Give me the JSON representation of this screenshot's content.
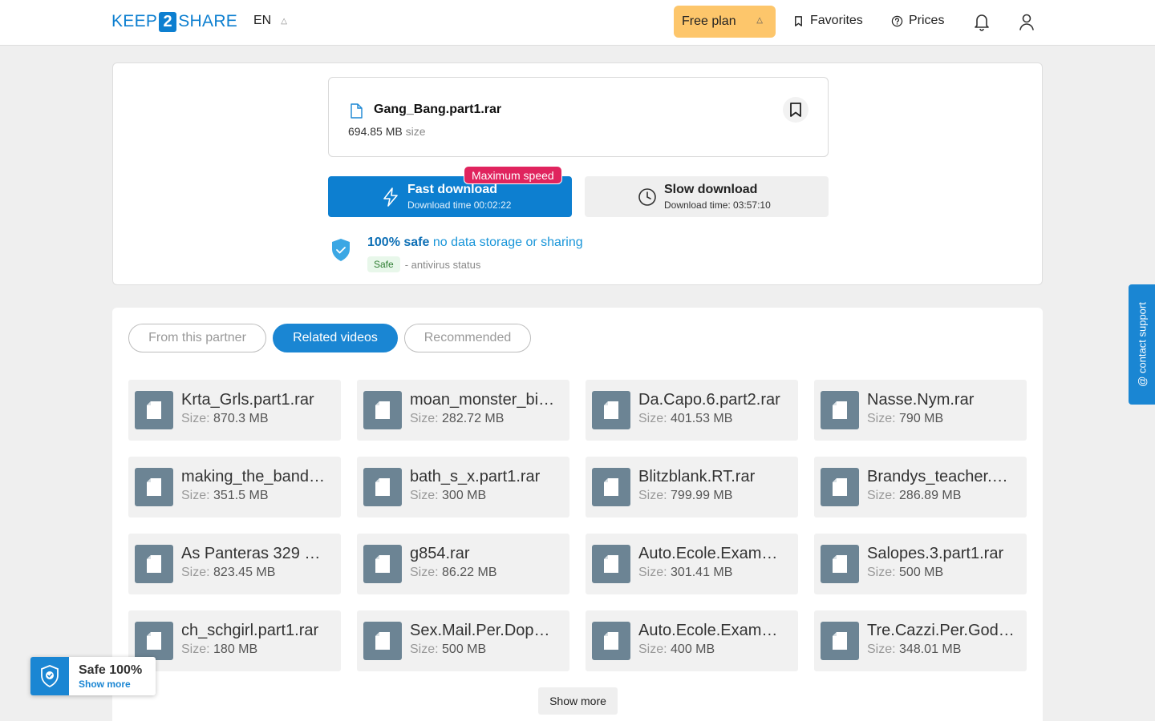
{
  "header": {
    "logo_left": "KEEP",
    "logo_mid": "2",
    "logo_right": "SHARE",
    "lang": "EN",
    "plan": "Free plan",
    "favorites": "Favorites",
    "prices": "Prices"
  },
  "file": {
    "name": "Gang_Bang.part1.rar",
    "size": "694.85 MB",
    "size_label": "size"
  },
  "download": {
    "badge": "Maximum speed",
    "fast_label": "Fast download",
    "fast_time": "Download time 00:02:22",
    "slow_label": "Slow download",
    "slow_time": "Download time: 03:57:10"
  },
  "safety": {
    "strong": "100% safe",
    "rest": "no data storage or sharing",
    "badge": "Safe",
    "status": "- antivirus status"
  },
  "tabs": [
    {
      "label": "From this partner"
    },
    {
      "label": "Related videos"
    },
    {
      "label": "Recommended"
    }
  ],
  "size_prefix": "Size:",
  "items": [
    {
      "name": "Krta_Grls.part1.rar",
      "size": "870.3 MB"
    },
    {
      "name": "moan_monster_bi…",
      "size": "282.72 MB"
    },
    {
      "name": "Da.Capo.6.part2.rar",
      "size": "401.53 MB"
    },
    {
      "name": "Nasse.Nym.rar",
      "size": "790 MB"
    },
    {
      "name": "making_the_band…",
      "size": "351.5 MB"
    },
    {
      "name": "bath_s_x.part1.rar",
      "size": "300 MB"
    },
    {
      "name": "Blitzblank.RT.rar",
      "size": "799.99 MB"
    },
    {
      "name": "Brandys_teacher.…",
      "size": "286.89 MB"
    },
    {
      "name": "As Panteras 329 …",
      "size": "823.45 MB"
    },
    {
      "name": "g854.rar",
      "size": "86.22 MB"
    },
    {
      "name": "Auto.Ecole.Exame…",
      "size": "301.41 MB"
    },
    {
      "name": "Salopes.3.part1.rar",
      "size": "500 MB"
    },
    {
      "name": "ch_schgirl.part1.rar",
      "size": "180 MB"
    },
    {
      "name": "Sex.Mail.Per.Dop…",
      "size": "500 MB"
    },
    {
      "name": "Auto.Ecole.Exame…",
      "size": "400 MB"
    },
    {
      "name": "Tre.Cazzi.Per.God…",
      "size": "348.01 MB"
    }
  ],
  "show_more": "Show more",
  "support": "@ contact support",
  "widget": {
    "title": "Safe 100%",
    "link": "Show more"
  }
}
